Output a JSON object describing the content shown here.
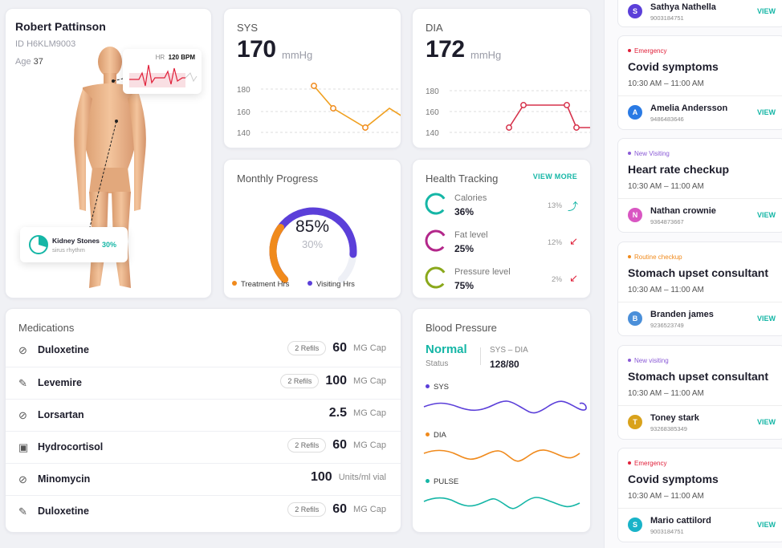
{
  "patient": {
    "name": "Robert Pattinson",
    "id_label": "ID",
    "id": "H6KLM9003",
    "age_label": "Age",
    "age": "37",
    "hr_label": "HR",
    "hr_value": "120 BPM",
    "condition_name": "Kidney Stones",
    "condition_sub": "sirus rhythm",
    "condition_pct": "30%"
  },
  "sys": {
    "title": "SYS",
    "value": "170",
    "unit": "mmHg",
    "ticks": [
      "180",
      "160",
      "140"
    ]
  },
  "dia": {
    "title": "DIA",
    "value": "172",
    "unit": "mmHg",
    "ticks": [
      "180",
      "160",
      "140"
    ]
  },
  "monthly": {
    "title": "Monthly Progress",
    "primary": "85%",
    "secondary": "30%",
    "primary_fraction": 0.85,
    "secondary_fraction": 0.3,
    "legend_1": "Treatment Hrs",
    "legend_2": "Visiting Hrs",
    "color_1": "#f08a1c",
    "color_2": "#5b3fd9"
  },
  "health": {
    "title": "Health Tracking",
    "view_more": "VIEW MORE",
    "items": [
      {
        "name": "Calories",
        "value": "36%",
        "pct": "13%",
        "arrow": "⤴",
        "color": "#15b6a6",
        "arrow_color": "#15b6a6"
      },
      {
        "name": "Fat level",
        "value": "25%",
        "pct": "12%",
        "arrow": "↙",
        "color": "#b3278a",
        "arrow_color": "#e0203a"
      },
      {
        "name": "Pressure level",
        "value": "75%",
        "pct": "2%",
        "arrow": "↙",
        "color": "#8aa81b",
        "arrow_color": "#e0203a"
      }
    ]
  },
  "meds": {
    "title": "Medications",
    "items": [
      {
        "icon": "pill-icon",
        "name": "Duloxetine",
        "refills": "2 Refils",
        "amount": "60",
        "unit": "MG Cap"
      },
      {
        "icon": "syringe-icon",
        "name": "Levemire",
        "refills": "2 Refils",
        "amount": "100",
        "unit": "MG Cap"
      },
      {
        "icon": "pill-icon",
        "name": "Lorsartan",
        "refills": "",
        "amount": "2.5",
        "unit": "MG Cap"
      },
      {
        "icon": "clipboard-icon",
        "name": "Hydrocortisol",
        "refills": "2 Refils",
        "amount": "60",
        "unit": "MG Cap"
      },
      {
        "icon": "pill-icon",
        "name": "Minomycin",
        "refills": "",
        "amount": "100",
        "unit": "Units/ml vial"
      },
      {
        "icon": "syringe-icon",
        "name": "Duloxetine",
        "refills": "2 Refils",
        "amount": "60",
        "unit": "MG Cap"
      }
    ]
  },
  "bp": {
    "title": "Blood Pressure",
    "status_value": "Normal",
    "status_label": "Status",
    "reading_label": "SYS – DIA",
    "reading": "128/80",
    "series": [
      {
        "name": "SYS",
        "color": "#5b3fd9"
      },
      {
        "name": "DIA",
        "color": "#f08a1c"
      },
      {
        "name": "PULSE",
        "color": "#15b6a6"
      }
    ]
  },
  "appointments": {
    "top_person": {
      "initial": "S",
      "name": "Sathya Nathella",
      "phone": "9003184751",
      "action": "VIEW",
      "color": "#5b3fd9"
    },
    "cards": [
      {
        "tag": "Emergency",
        "tag_color": "#e0203a",
        "title": "Covid symptoms",
        "time": "10:30 AM – 11:00 AM",
        "person": {
          "initial": "A",
          "name": "Amelia Andersson",
          "phone": "9486483646",
          "action": "VIEW",
          "color": "#2a7ae4"
        }
      },
      {
        "tag": "New Visiting",
        "tag_color": "#8a5ad6",
        "title": "Heart rate checkup",
        "time": "10:30 AM – 11:00 AM",
        "person": {
          "initial": "N",
          "name": "Nathan crownie",
          "phone": "9364873667",
          "action": "VIEW",
          "color": "#d956c2"
        }
      },
      {
        "tag": "Routine checkup",
        "tag_color": "#f08a1c",
        "title": "Stomach upset consultant",
        "time": "10:30 AM – 11:00 AM",
        "person": {
          "initial": "B",
          "name": "Branden james",
          "phone": "9236523749",
          "action": "VIEW",
          "color": "#4a8fd9"
        }
      },
      {
        "tag": "New visiting",
        "tag_color": "#8a5ad6",
        "title": "Stomach upset consultant",
        "time": "10:30 AM – 11:00 AM",
        "person": {
          "initial": "T",
          "name": "Toney stark",
          "phone": "93268385349",
          "action": "VIEW",
          "color": "#d9a21b"
        }
      },
      {
        "tag": "Emergency",
        "tag_color": "#e0203a",
        "title": "Covid symptoms",
        "time": "10:30 AM – 11:00 AM",
        "person": {
          "initial": "S",
          "name": "Mario cattilord",
          "phone": "9003184751",
          "action": "VIEW",
          "color": "#19b3c8"
        }
      }
    ]
  }
}
